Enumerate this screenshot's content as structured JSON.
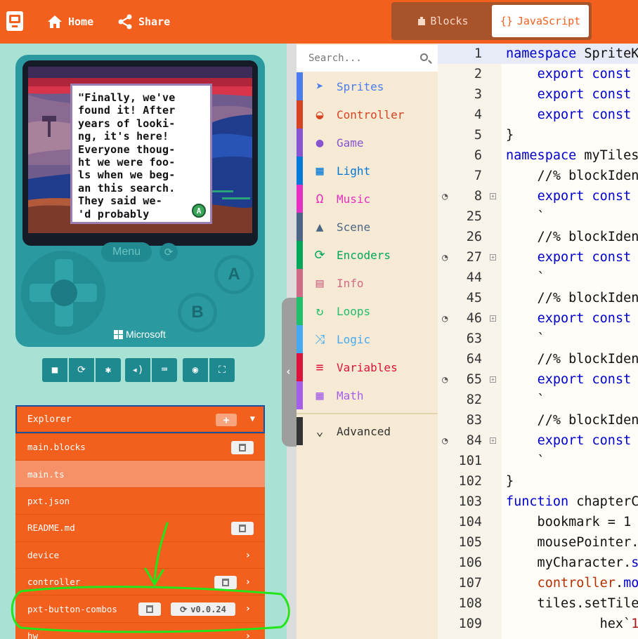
{
  "topbar": {
    "home_label": "Home",
    "share_label": "Share",
    "blocks_label": "Blocks",
    "javascript_label": "JavaScript",
    "javascript_icon": "{}"
  },
  "simulator": {
    "dialog_text": "\"Finally, we've\nfound it! After\nyears of looki-\nng, it's here!\nEveryone thoug-\nht we were foo-\nls when we beg-\nan this search.\nThey said we-\n'd probably",
    "menu_label": "Menu",
    "button_a": "A",
    "button_b": "B",
    "brand": "Microsoft",
    "dialog_badge": "A"
  },
  "explorer": {
    "title": "Explorer",
    "rows": [
      {
        "name": "main.blocks"
      },
      {
        "name": "main.ts"
      },
      {
        "name": "pxt.json"
      },
      {
        "name": "README.md"
      },
      {
        "name": "device"
      },
      {
        "name": "controller"
      },
      {
        "name": "pxt-button-combos",
        "version": "v0.0.24"
      },
      {
        "name": "hw"
      }
    ]
  },
  "toolbox": {
    "search_placeholder": "Search...",
    "categories": [
      {
        "label": "Sprites",
        "color": "#4b7bec"
      },
      {
        "label": "Controller",
        "color": "#d54322"
      },
      {
        "label": "Game",
        "color": "#8854d0"
      },
      {
        "label": "Light",
        "color": "#0078d7"
      },
      {
        "label": "Music",
        "color": "#e52fc1"
      },
      {
        "label": "Scene",
        "color": "#4b6584"
      },
      {
        "label": "Encoders",
        "color": "#00a65a"
      },
      {
        "label": "Info",
        "color": "#cf6a87"
      },
      {
        "label": "Loops",
        "color": "#20bf6b"
      },
      {
        "label": "Logic",
        "color": "#45aaf2"
      },
      {
        "label": "Variables",
        "color": "#dc143c"
      },
      {
        "label": "Math",
        "color": "#a55eea"
      }
    ],
    "advanced_label": "Advanced"
  },
  "editor": {
    "lines": [
      {
        "n": "1",
        "code": "namespace SpriteK"
      },
      {
        "n": "2",
        "code": "    export const"
      },
      {
        "n": "3",
        "code": "    export const"
      },
      {
        "n": "4",
        "code": "    export const"
      },
      {
        "n": "5",
        "code": "}"
      },
      {
        "n": "6",
        "code": "namespace myTiles"
      },
      {
        "n": "7",
        "code": "    //% blockIden"
      },
      {
        "n": "8",
        "code": "    export const"
      },
      {
        "n": "25",
        "code": "    `"
      },
      {
        "n": "26",
        "code": "    //% blockIden"
      },
      {
        "n": "27",
        "code": "    export const"
      },
      {
        "n": "44",
        "code": "    `"
      },
      {
        "n": "45",
        "code": "    //% blockIden"
      },
      {
        "n": "46",
        "code": "    export const"
      },
      {
        "n": "63",
        "code": "    `"
      },
      {
        "n": "64",
        "code": "    //% blockIden"
      },
      {
        "n": "65",
        "code": "    export const"
      },
      {
        "n": "82",
        "code": "    `"
      },
      {
        "n": "83",
        "code": "    //% blockIden"
      },
      {
        "n": "84",
        "code": "    export const"
      },
      {
        "n": "101",
        "code": "    `"
      },
      {
        "n": "102",
        "code": "}"
      },
      {
        "n": "103",
        "code": "function chapterC"
      },
      {
        "n": "104",
        "code": "    bookmark = 1"
      },
      {
        "n": "105",
        "code": "    mousePointer."
      },
      {
        "n": "106",
        "code": "    myCharacter.s"
      },
      {
        "n": "107",
        "code": "    controller.mo"
      },
      {
        "n": "108",
        "code": "    tiles.setTile"
      },
      {
        "n": "109",
        "code": "            hex`1"
      }
    ]
  },
  "colors": {
    "brand_orange": "#f3601d",
    "annotation_green": "#22e51a"
  }
}
